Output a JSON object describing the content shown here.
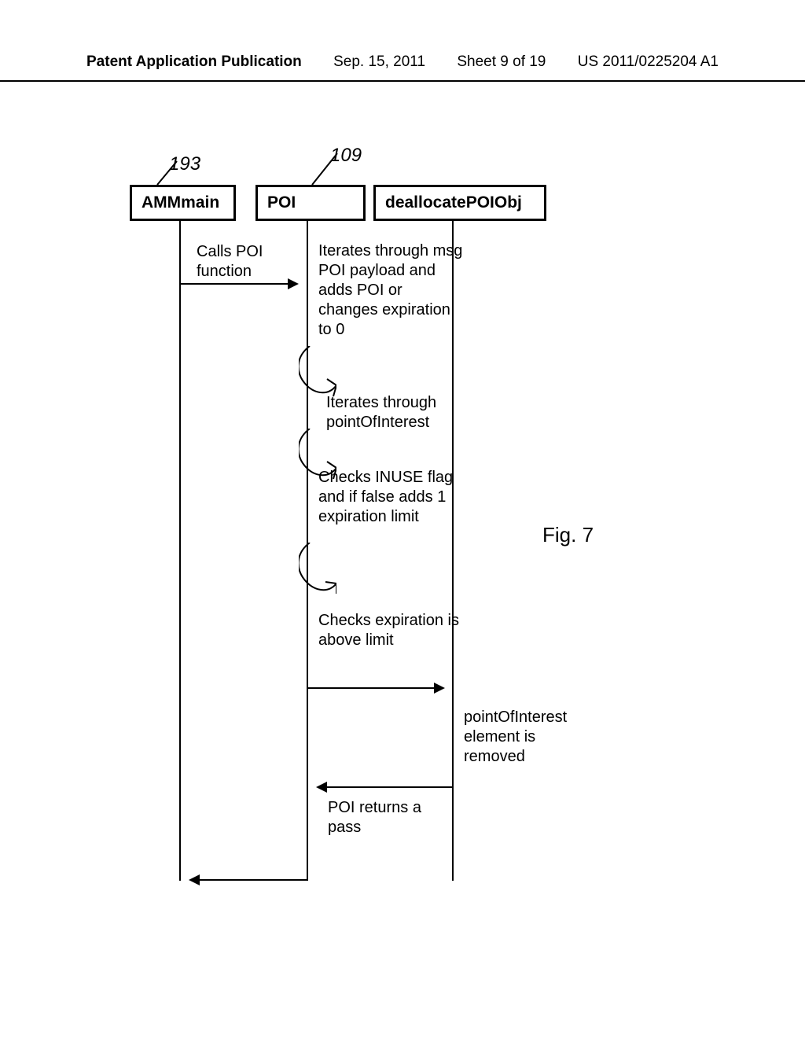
{
  "header": {
    "left": "Patent Application Publication",
    "date": "Sep. 15, 2011",
    "sheet": "Sheet 9 of 19",
    "docnum": "US 2011/0225204 A1"
  },
  "refs": {
    "a": "193",
    "b": "109"
  },
  "lanes": {
    "a": "AMMmain",
    "b": "POI",
    "c": "deallocatePOIObj"
  },
  "msgs": {
    "call": "Calls POI function",
    "iter1": "Iterates through msg POI payload and adds POI or changes expiration to 0",
    "iter2": "Iterates through pointOfInterest",
    "check1": "Checks INUSE flag and if false adds 1 expiration limit",
    "check2": "Checks expiration is above limit",
    "removed": "pointOfInterest element is removed",
    "return": "POI returns a pass"
  },
  "figure": "Fig. 7"
}
